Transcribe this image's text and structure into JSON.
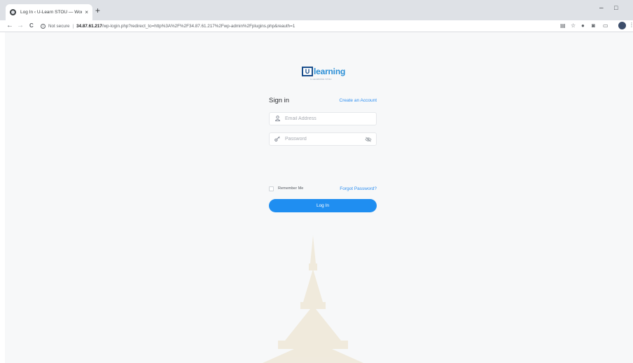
{
  "browser": {
    "tab_title": "Log In ‹ U-Learn STOU — WordP",
    "tab_close": "×",
    "new_tab": "+",
    "nav": {
      "back": "←",
      "forward": "→",
      "reload": "C"
    },
    "security_label": "Not secure",
    "url_host": "34.87.61.217",
    "url_path": "/wp-login.php?redirect_to=http%3A%2F%2F34.87.61.217%2Fwp-admin%2Fplugins.php&reauth=1",
    "window_controls": {
      "minimize": "–",
      "maximize": "□"
    },
    "icons": [
      "translate-icon",
      "star-icon",
      "extension-icon",
      "camera-icon",
      "cast-icon",
      "avatar",
      "menu-icon"
    ]
  },
  "logo": {
    "mark": "U",
    "text": "learning",
    "tagline": "U-LEARNING STOU"
  },
  "form": {
    "title": "Sign in",
    "create_account": "Create an Account",
    "email_placeholder": "Email Address",
    "password_placeholder": "Password",
    "remember_label": "Remember Me",
    "forgot_label": "Forgot Password?",
    "login_label": "Log In"
  },
  "colors": {
    "accent": "#1f8ef1",
    "link": "#2f8ff0",
    "logo_dark": "#1a4e8c",
    "logo_light": "#2b8fd6",
    "page_bg": "#f7f8f9"
  }
}
